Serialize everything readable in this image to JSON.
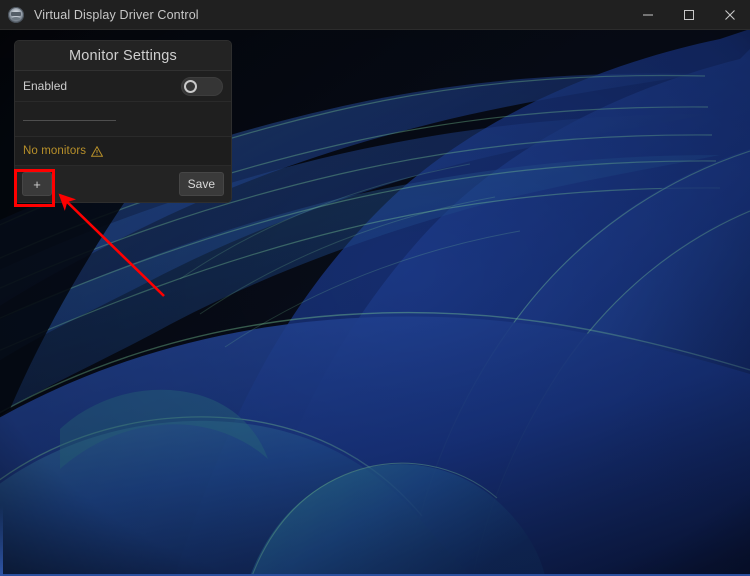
{
  "window": {
    "title": "Virtual Display Driver Control",
    "app_icon": "app-logo-icon",
    "controls": {
      "minimize": "minimize-icon",
      "maximize": "maximize-icon",
      "close": "close-icon"
    }
  },
  "panel": {
    "title": "Monitor Settings",
    "enabled": {
      "label": "Enabled",
      "state": "off"
    },
    "status": {
      "text": "No monitors",
      "icon": "warning-triangle-icon",
      "color": "#b8902a"
    },
    "footer": {
      "add_label": "+",
      "save_label": "Save"
    }
  },
  "annotations": {
    "highlight_color": "#ff0000",
    "arrow_color": "#ff0000",
    "highlight_target": "add-monitor-button"
  },
  "desktop": {
    "wallpaper_name": "windows-11-bloom-wallpaper"
  }
}
